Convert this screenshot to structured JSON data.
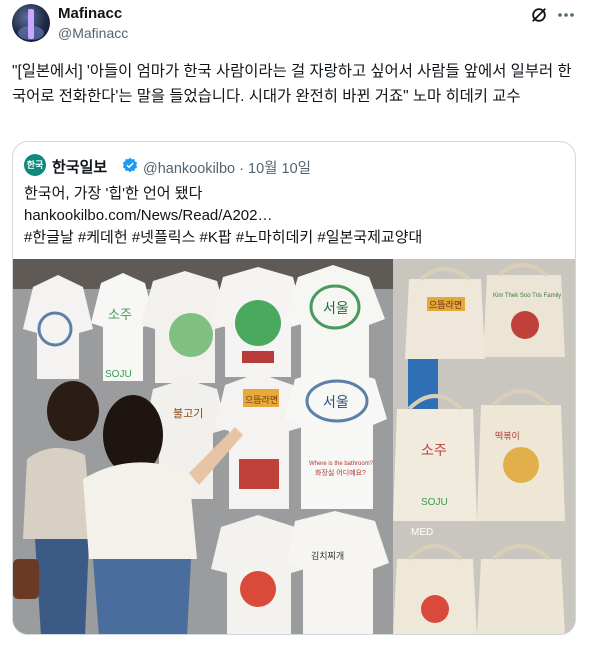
{
  "author": {
    "display_name": "Mafinacc",
    "handle": "@Mafinacc"
  },
  "icons": {
    "avatar": "avatar-image",
    "grok": "grok-icon",
    "more": "more-icon",
    "verified": "verified-badge-icon"
  },
  "tweet": {
    "text": "\"[일본에서] '아들이 엄마가 한국 사람이라는 걸 자랑하고 싶어서 사람들 앞에서 일부러 한국어로 전화한다'는 말을 들었습니다. 시대가 완전히 바뀐 거죠\" 노마 히데키 교수"
  },
  "quote": {
    "logo_text": "한국",
    "source_name": "한국일보",
    "source_handle": "@hankookilbo",
    "separator": "·",
    "date": "10월 10일",
    "headline": "한국어, 가장 '힙'한 언어 됐다",
    "link": "hankookilbo.com/News/Read/A202…",
    "hashtags": "#한글날 #케데헌 #넷플릭스 #K팝 #노마히데키 #일본국제교양대"
  },
  "photo": {
    "shirt_texts": [
      "서울",
      "서울",
      "소주",
      "SOJU",
      "으뜸라면",
      "Where is the bathroom?",
      "화장실 어디예요?",
      "불고기",
      "김치찌개"
    ],
    "bag_texts": [
      "으뜸라면",
      "Kim Thek Soo Tris Family",
      "소주",
      "SOJU",
      "떡볶이"
    ],
    "sign_text": "MED"
  },
  "colors": {
    "accent": "#1d9bf0",
    "secondary_text": "#536471",
    "border": "#cfd9de",
    "logo_bg": "#0d8a7d"
  }
}
